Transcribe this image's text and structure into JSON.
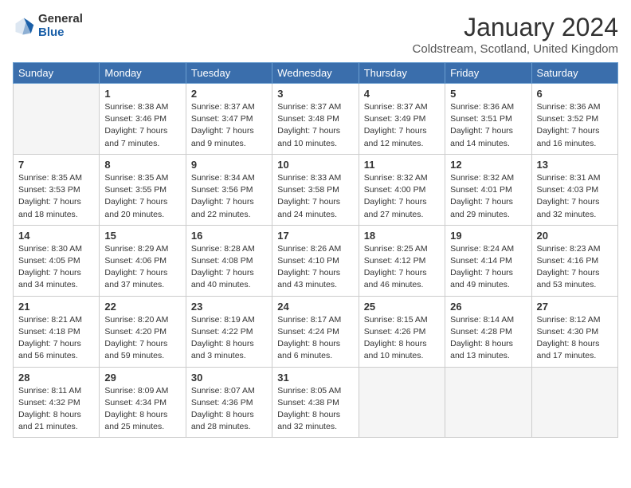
{
  "header": {
    "logo_general": "General",
    "logo_blue": "Blue",
    "title": "January 2024",
    "subtitle": "Coldstream, Scotland, United Kingdom"
  },
  "days_of_week": [
    "Sunday",
    "Monday",
    "Tuesday",
    "Wednesday",
    "Thursday",
    "Friday",
    "Saturday"
  ],
  "weeks": [
    [
      {
        "day": "",
        "sunrise": "",
        "sunset": "",
        "daylight": ""
      },
      {
        "day": "1",
        "sunrise": "8:38 AM",
        "sunset": "3:46 PM",
        "daylight": "7 hours and 7 minutes."
      },
      {
        "day": "2",
        "sunrise": "8:37 AM",
        "sunset": "3:47 PM",
        "daylight": "7 hours and 9 minutes."
      },
      {
        "day": "3",
        "sunrise": "8:37 AM",
        "sunset": "3:48 PM",
        "daylight": "7 hours and 10 minutes."
      },
      {
        "day": "4",
        "sunrise": "8:37 AM",
        "sunset": "3:49 PM",
        "daylight": "7 hours and 12 minutes."
      },
      {
        "day": "5",
        "sunrise": "8:36 AM",
        "sunset": "3:51 PM",
        "daylight": "7 hours and 14 minutes."
      },
      {
        "day": "6",
        "sunrise": "8:36 AM",
        "sunset": "3:52 PM",
        "daylight": "7 hours and 16 minutes."
      }
    ],
    [
      {
        "day": "7",
        "sunrise": "8:35 AM",
        "sunset": "3:53 PM",
        "daylight": "7 hours and 18 minutes."
      },
      {
        "day": "8",
        "sunrise": "8:35 AM",
        "sunset": "3:55 PM",
        "daylight": "7 hours and 20 minutes."
      },
      {
        "day": "9",
        "sunrise": "8:34 AM",
        "sunset": "3:56 PM",
        "daylight": "7 hours and 22 minutes."
      },
      {
        "day": "10",
        "sunrise": "8:33 AM",
        "sunset": "3:58 PM",
        "daylight": "7 hours and 24 minutes."
      },
      {
        "day": "11",
        "sunrise": "8:32 AM",
        "sunset": "4:00 PM",
        "daylight": "7 hours and 27 minutes."
      },
      {
        "day": "12",
        "sunrise": "8:32 AM",
        "sunset": "4:01 PM",
        "daylight": "7 hours and 29 minutes."
      },
      {
        "day": "13",
        "sunrise": "8:31 AM",
        "sunset": "4:03 PM",
        "daylight": "7 hours and 32 minutes."
      }
    ],
    [
      {
        "day": "14",
        "sunrise": "8:30 AM",
        "sunset": "4:05 PM",
        "daylight": "7 hours and 34 minutes."
      },
      {
        "day": "15",
        "sunrise": "8:29 AM",
        "sunset": "4:06 PM",
        "daylight": "7 hours and 37 minutes."
      },
      {
        "day": "16",
        "sunrise": "8:28 AM",
        "sunset": "4:08 PM",
        "daylight": "7 hours and 40 minutes."
      },
      {
        "day": "17",
        "sunrise": "8:26 AM",
        "sunset": "4:10 PM",
        "daylight": "7 hours and 43 minutes."
      },
      {
        "day": "18",
        "sunrise": "8:25 AM",
        "sunset": "4:12 PM",
        "daylight": "7 hours and 46 minutes."
      },
      {
        "day": "19",
        "sunrise": "8:24 AM",
        "sunset": "4:14 PM",
        "daylight": "7 hours and 49 minutes."
      },
      {
        "day": "20",
        "sunrise": "8:23 AM",
        "sunset": "4:16 PM",
        "daylight": "7 hours and 53 minutes."
      }
    ],
    [
      {
        "day": "21",
        "sunrise": "8:21 AM",
        "sunset": "4:18 PM",
        "daylight": "7 hours and 56 minutes."
      },
      {
        "day": "22",
        "sunrise": "8:20 AM",
        "sunset": "4:20 PM",
        "daylight": "7 hours and 59 minutes."
      },
      {
        "day": "23",
        "sunrise": "8:19 AM",
        "sunset": "4:22 PM",
        "daylight": "8 hours and 3 minutes."
      },
      {
        "day": "24",
        "sunrise": "8:17 AM",
        "sunset": "4:24 PM",
        "daylight": "8 hours and 6 minutes."
      },
      {
        "day": "25",
        "sunrise": "8:15 AM",
        "sunset": "4:26 PM",
        "daylight": "8 hours and 10 minutes."
      },
      {
        "day": "26",
        "sunrise": "8:14 AM",
        "sunset": "4:28 PM",
        "daylight": "8 hours and 13 minutes."
      },
      {
        "day": "27",
        "sunrise": "8:12 AM",
        "sunset": "4:30 PM",
        "daylight": "8 hours and 17 minutes."
      }
    ],
    [
      {
        "day": "28",
        "sunrise": "8:11 AM",
        "sunset": "4:32 PM",
        "daylight": "8 hours and 21 minutes."
      },
      {
        "day": "29",
        "sunrise": "8:09 AM",
        "sunset": "4:34 PM",
        "daylight": "8 hours and 25 minutes."
      },
      {
        "day": "30",
        "sunrise": "8:07 AM",
        "sunset": "4:36 PM",
        "daylight": "8 hours and 28 minutes."
      },
      {
        "day": "31",
        "sunrise": "8:05 AM",
        "sunset": "4:38 PM",
        "daylight": "8 hours and 32 minutes."
      },
      {
        "day": "",
        "sunrise": "",
        "sunset": "",
        "daylight": ""
      },
      {
        "day": "",
        "sunrise": "",
        "sunset": "",
        "daylight": ""
      },
      {
        "day": "",
        "sunrise": "",
        "sunset": "",
        "daylight": ""
      }
    ]
  ]
}
